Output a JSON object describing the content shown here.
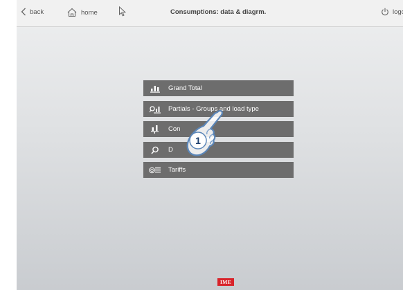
{
  "header": {
    "back_label": "back",
    "home_label": "home",
    "title": "Consumptions: data & diagrm.",
    "logout_label": "logo"
  },
  "menu": {
    "items": [
      {
        "label": "Grand Total",
        "icon": "grand-total-icon"
      },
      {
        "label": "Partials - Groups and load type",
        "icon": "partials-icon"
      },
      {
        "label": "Con",
        "icon": "consumptions-icon"
      },
      {
        "label": "D",
        "icon": "search-icon"
      },
      {
        "label": "Tariffs",
        "icon": "tariffs-icon"
      }
    ]
  },
  "overlay": {
    "step_number": "1"
  },
  "footer": {
    "brand": "IME"
  },
  "colors": {
    "menu_bg": "#6d6d6d",
    "brand_red": "#d8232a"
  }
}
